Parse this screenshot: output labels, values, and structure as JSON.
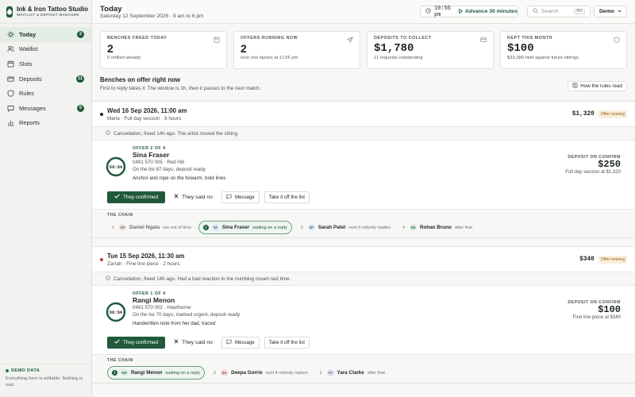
{
  "brand": {
    "name": "Ink & Iron Tattoo Studio",
    "subtitle": "WAITLIST & DEPOSIT MANAGER"
  },
  "nav": [
    {
      "label": "Today",
      "badge": "2",
      "active": true,
      "icon": "sun-icon"
    },
    {
      "label": "Waitlist",
      "badge": "",
      "icon": "list-icon"
    },
    {
      "label": "Slots",
      "badge": "",
      "icon": "calendar-icon"
    },
    {
      "label": "Deposits",
      "badge": "11",
      "icon": "card-icon"
    },
    {
      "label": "Rules",
      "badge": "",
      "icon": "rules-icon"
    },
    {
      "label": "Messages",
      "badge": "5",
      "icon": "message-icon"
    },
    {
      "label": "Reports",
      "badge": "",
      "icon": "chart-icon"
    }
  ],
  "demo": {
    "label": "DEMO DATA",
    "text": "Everything here is editable. Nothing is real."
  },
  "header": {
    "title": "Today",
    "subtitle": "Saturday 12 September 2026 · 9 am to 6 pm",
    "time": "10:56 pm",
    "advance": "Advance 30 minutes",
    "search_placeholder": "Search",
    "search_kbd": "⌘K",
    "demo_label": "Demo"
  },
  "stats": [
    {
      "label": "BENCHES FREED TODAY",
      "value": "2",
      "sub": "0 refilled already",
      "icon": "calendar-icon"
    },
    {
      "label": "OFFERS RUNNING NOW",
      "value": "2",
      "sub": "next one lapses at 11:56 pm",
      "icon": "send-icon"
    },
    {
      "label": "DEPOSITS TO COLLECT",
      "value": "$1,780",
      "sub": "11 requests outstanding",
      "icon": "card-icon"
    },
    {
      "label": "KEPT THIS MONTH",
      "value": "$100",
      "sub": "$33,380 held against future sittings",
      "icon": "shield-icon"
    }
  ],
  "section": {
    "title": "Benches on offer right now",
    "subtitle": "First to reply takes it. The window is 1h, then it passes to the next match.",
    "rules_button": "How the rules read"
  },
  "offers": [
    {
      "date": "Wed 16 Sep 2026, 11:00 am",
      "artist_line": "Maria · Full day session · 6 hours",
      "amount": "$1,320",
      "status": "Offer running",
      "note": "Cancellation, freed 14h ago. The artist moved the sitting.",
      "countdown": "59:56",
      "remaining": 0.98,
      "offer_label": "OFFER 2 OF 4",
      "name": "Sina Fraser",
      "contact": "0491 570 005 · Red Hill",
      "list_info": "On the list 87 days, deposit ready",
      "tattoo": "Anchor and rope on the forearm, bold lines",
      "deposit_label": "DEPOSIT ON CONFIRM",
      "deposit": "$250",
      "deposit_sub": "Full day session at $1,320",
      "actions": {
        "confirm": "They confirmed",
        "no": "They said no",
        "message": "Message",
        "remove": "Take it off the list"
      },
      "chain_label": "THE CHAIN",
      "chain": [
        {
          "num": "1",
          "initials": "DN",
          "name": "Daniel Ngata",
          "status": "ran out of time",
          "state": "muted",
          "color": "#ece4e1",
          "tcolor": "#8a6b62"
        },
        {
          "num": "2",
          "initials": "SF",
          "name": "Sina Fraser",
          "status": "waiting on a reply",
          "state": "cur",
          "color": "#dde9ef",
          "tcolor": "#3c6a85"
        },
        {
          "num": "3",
          "initials": "SP",
          "name": "Sarah Patel",
          "status": "next if nobody replies",
          "state": "",
          "color": "#dde9ef",
          "tcolor": "#3c6a85"
        },
        {
          "num": "4",
          "initials": "RB",
          "name": "Rohan Bruno",
          "status": "after that",
          "state": "",
          "color": "#dcece0",
          "tcolor": "#3e7a52"
        }
      ]
    },
    {
      "date": "Tue 15 Sep 2026, 11:30 am",
      "artist_line": "Zarrah · Fine line piece · 2 hours",
      "amount": "$340",
      "status": "Offer running",
      "note": "Cancellation, freed 14h ago. Had a bad reaction to the numbing cream last time.",
      "countdown": "59:56",
      "remaining": 0.98,
      "offer_label": "OFFER 1 OF 4",
      "name": "Rangi Menon",
      "contact": "0491 570 002 · Hawthorne",
      "list_info": "On the list 70 days, marked urgent, deposit ready",
      "tattoo": "Handwritten note from her dad, traced",
      "deposit_label": "DEPOSIT ON CONFIRM",
      "deposit": "$100",
      "deposit_sub": "Fine line piece at $340",
      "actions": {
        "confirm": "They confirmed",
        "no": "They said no",
        "message": "Message",
        "remove": "Take it off the list"
      },
      "chain_label": "THE CHAIN",
      "chain": [
        {
          "num": "1",
          "initials": "RM",
          "name": "Rangi Menon",
          "status": "waiting on a reply",
          "state": "cur",
          "color": "#dcece0",
          "tcolor": "#3e7a52"
        },
        {
          "num": "2",
          "initials": "DG",
          "name": "Deepa Gorrie",
          "status": "next if nobody replies",
          "state": "",
          "color": "#f2dde0",
          "tcolor": "#9a4a58"
        },
        {
          "num": "3",
          "initials": "YC",
          "name": "Yara Clarke",
          "status": "after that",
          "state": "",
          "color": "#e6def0",
          "tcolor": "#6a4f8a"
        }
      ]
    }
  ]
}
